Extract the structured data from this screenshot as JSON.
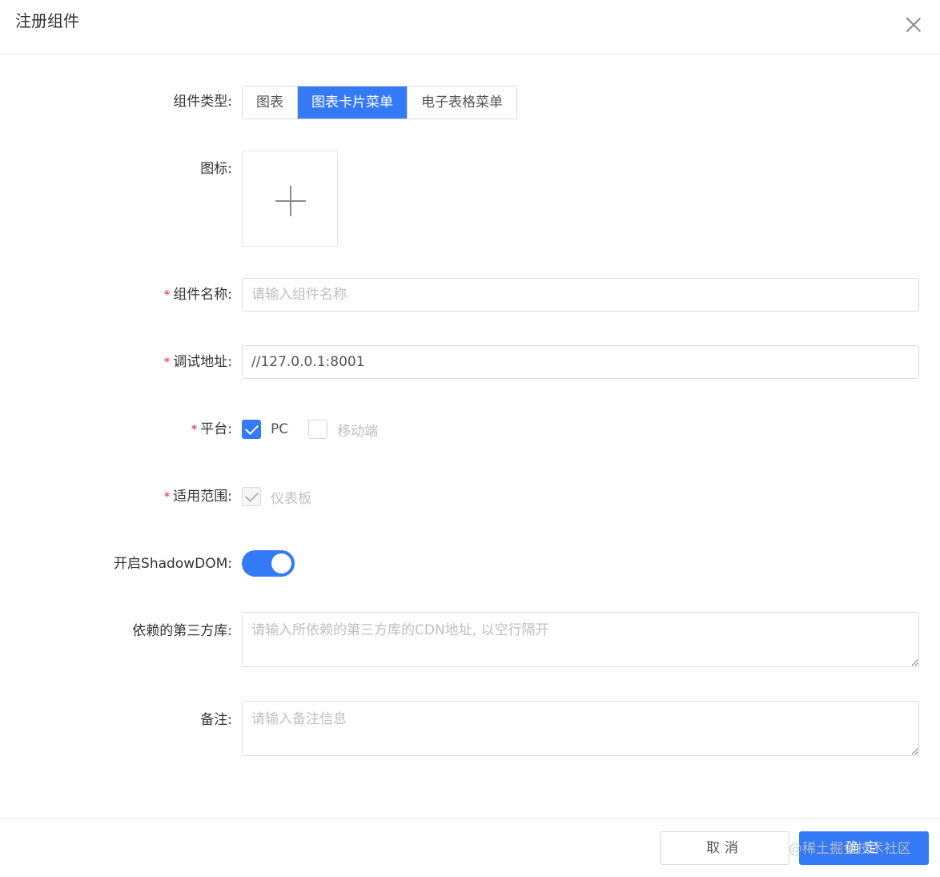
{
  "dialog": {
    "title": "注册组件"
  },
  "form": {
    "component_type": {
      "label": "组件类型:",
      "options": [
        "图表",
        "图表卡片菜单",
        "电子表格菜单"
      ],
      "selected": "图表卡片菜单"
    },
    "icon": {
      "label": "图标:"
    },
    "component_name": {
      "label": "组件名称:",
      "placeholder": "请输入组件名称",
      "value": ""
    },
    "debug_url": {
      "label": "调试地址:",
      "value": "//127.0.0.1:8001"
    },
    "platform": {
      "label": "平台:",
      "options": [
        {
          "label": "PC",
          "checked": true
        },
        {
          "label": "移动端",
          "checked": false
        }
      ]
    },
    "scope": {
      "label": "适用范围:",
      "options": [
        {
          "label": "仪表板",
          "checked": true,
          "disabled": true
        }
      ]
    },
    "shadow_dom": {
      "label": "开启ShadowDOM:",
      "enabled": true
    },
    "dependencies": {
      "label": "依赖的第三方库:",
      "placeholder": "请输入所依赖的第三方库的CDN地址, 以空行隔开"
    },
    "remarks": {
      "label": "备注:",
      "placeholder": "请输入备注信息"
    },
    "required_mark": "*"
  },
  "footer": {
    "cancel_label": "取消",
    "ok_label": "确定",
    "watermark": "@稀土掘金技术社区"
  },
  "colors": {
    "primary": "#3479f6",
    "required": "#f5222d"
  }
}
